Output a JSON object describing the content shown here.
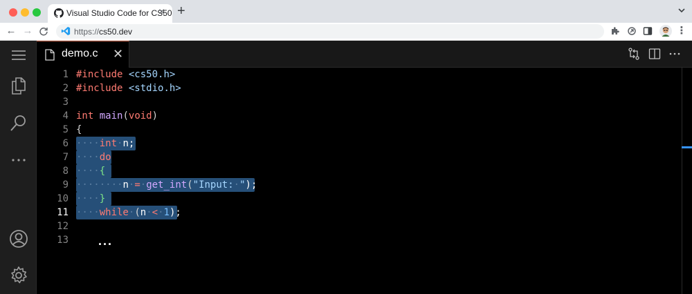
{
  "browser": {
    "tab_title": "Visual Studio Code for CS50",
    "tab_icon": "github-icon",
    "new_tab_label": "+",
    "url_scheme": "https://",
    "url_host": "cs50.dev"
  },
  "editor": {
    "tab_name": "demo.c",
    "tab_close": "✕",
    "accent_color": "#d36b4f",
    "selection_color": "#264f78",
    "active_line": 11,
    "line_numbers": [
      "1",
      "2",
      "3",
      "4",
      "5",
      "6",
      "7",
      "8",
      "9",
      "10",
      "11",
      "12",
      "13"
    ],
    "ellipsis": "..."
  },
  "code": {
    "l1_pp": "#include",
    "l1_inc": "<cs50.h>",
    "l2_pp": "#include",
    "l2_inc": "<stdio.h>",
    "l4_type": "int",
    "l4_fn": "main",
    "l4_open": "(",
    "l4_void": "void",
    "l4_close": ")",
    "l5_brace": "{",
    "l6_ws": "····",
    "l6_type": "int",
    "l6_ws2": "·",
    "l6_rest": "n;",
    "l7_ws": "····",
    "l7_kw": "do",
    "l8_ws": "····",
    "l8_brace": "{",
    "l9_ws": "········",
    "l9_var": "n",
    "l9_ws2": "·",
    "l9_op": "=",
    "l9_ws3": "·",
    "l9_fn": "get_int",
    "l9_open": "(",
    "l9_str_a": "\"Input:",
    "l9_ws4": "·",
    "l9_str_b": "\"",
    "l9_close": ");",
    "l10_ws": "····",
    "l10_brace": "}",
    "l11_ws": "····",
    "l11_kw": "while",
    "l11_ws2": "·",
    "l11_open": "(",
    "l11_var": "n",
    "l11_ws3": "·",
    "l11_op": "<",
    "l11_ws4": "·",
    "l11_num": "1",
    "l11_close": ");"
  }
}
